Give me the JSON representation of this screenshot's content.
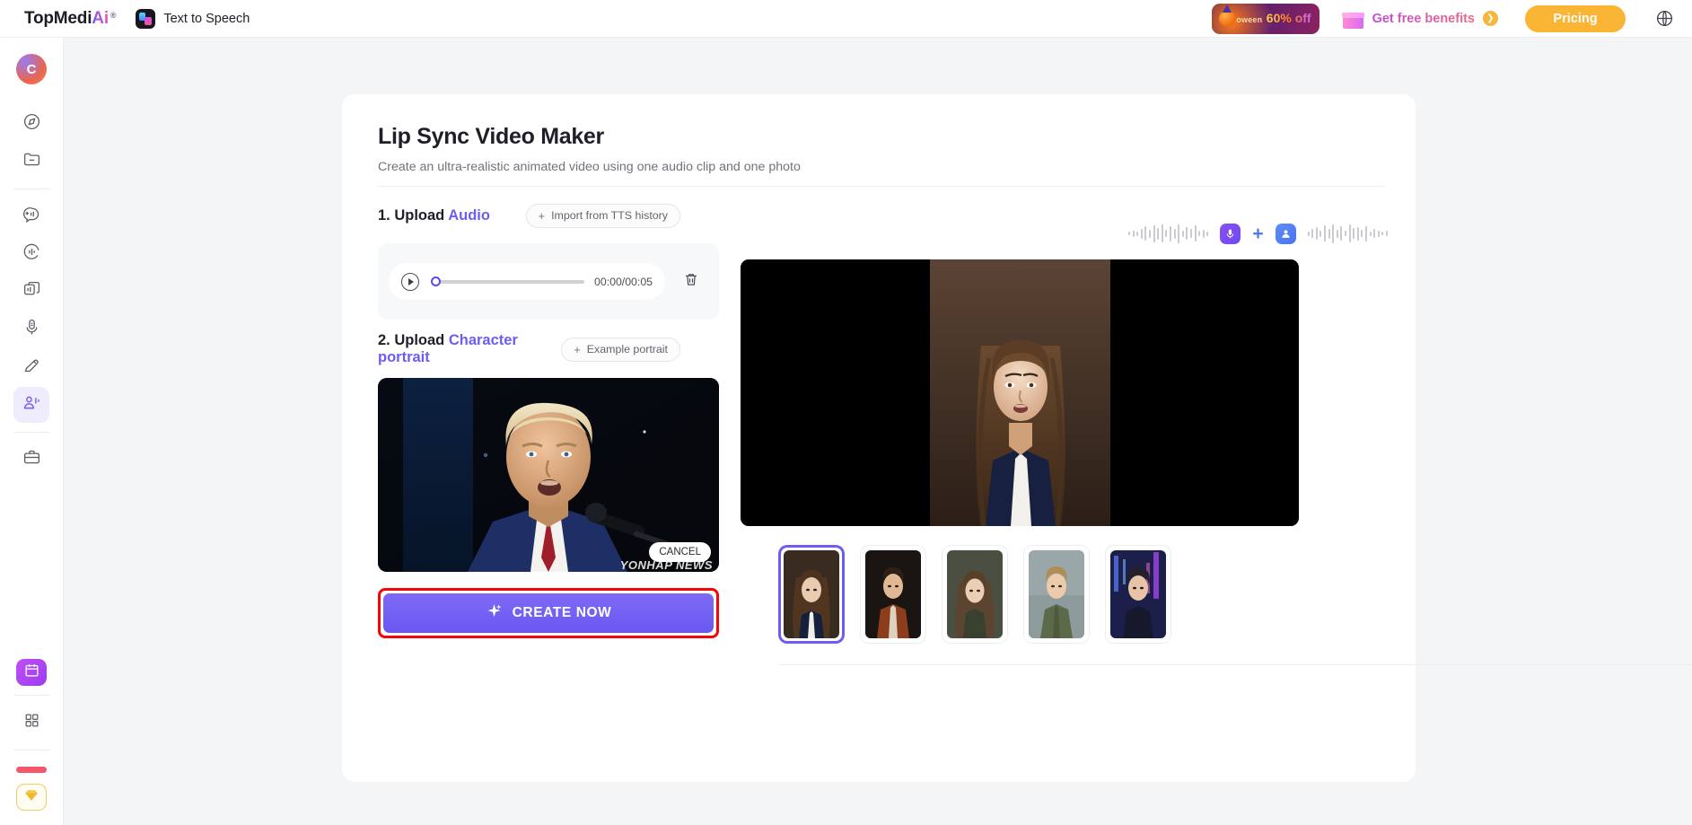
{
  "header": {
    "brand_main": "TopMedi",
    "brand_ai": "Ai",
    "brand_reg": "®",
    "app_name": "Text to Speech",
    "promo": {
      "line1": "Halloween",
      "line2": "60% off"
    },
    "benefits_label": "Get free benefits",
    "benefits_arrow": "❯",
    "pricing_label": "Pricing",
    "globe_icon": "globe-icon"
  },
  "sidebar": {
    "avatar_initial": "C",
    "items": [
      {
        "name": "sidebar-item-explore",
        "icon": "compass-icon"
      },
      {
        "name": "sidebar-item-folder",
        "icon": "folder-icon"
      },
      {
        "name": "sidebar-item-text-to-speech",
        "icon": "speech-bubble-icon"
      },
      {
        "name": "sidebar-item-voice-changer",
        "icon": "voice-wave-circle-icon"
      },
      {
        "name": "sidebar-item-voice-cloning",
        "icon": "layers-icon"
      },
      {
        "name": "sidebar-item-recorder",
        "icon": "microphone-icon"
      },
      {
        "name": "sidebar-item-ai-writer",
        "icon": "pen-icon"
      },
      {
        "name": "sidebar-item-lip-sync",
        "icon": "avatar-voice-icon",
        "active": true
      },
      {
        "name": "sidebar-item-toolbox",
        "icon": "briefcase-icon"
      }
    ],
    "calendar_tile": "calendar-icon",
    "apps_grid": "grid-apps-icon",
    "highlight_bar": "pink-bar",
    "diamond": "diamond-icon"
  },
  "card": {
    "title": "Lip Sync Video Maker",
    "subtitle": "Create an ultra-realistic animated video using one audio clip and one photo",
    "step1": {
      "prefix": "1. Upload ",
      "highlight": "Audio",
      "button": "Import from TTS history",
      "button_plus": "+"
    },
    "audio": {
      "play_icon": "play-icon",
      "progress_percent": 0,
      "timecode": "00:00/00:05",
      "delete_icon": "trash-icon"
    },
    "step2": {
      "prefix": "2. Upload ",
      "highlight": "Character portrait",
      "button": "Example portrait",
      "button_plus": "+"
    },
    "portrait": {
      "name": "uploaded-portrait",
      "cancel_label": "CANCEL",
      "watermark": "YONHAP NEWS"
    },
    "create_button": {
      "label": "CREATE NOW",
      "icon": "sparkle-icon",
      "highlight_color": "#f50606",
      "fill_color": "#6d5cf5"
    },
    "preview": {
      "combine_icons": [
        "waveform",
        "microphone-icon",
        "plus-icon",
        "person-icon",
        "waveform"
      ],
      "video_name": "generated-video-preview"
    },
    "gallery": [
      {
        "name": "portrait-thumb-1",
        "selected": true,
        "alt": "woman-navy-blazer"
      },
      {
        "name": "portrait-thumb-2",
        "selected": false,
        "alt": "man-rust-coat"
      },
      {
        "name": "portrait-thumb-3",
        "selected": false,
        "alt": "woman-olive-top"
      },
      {
        "name": "portrait-thumb-4",
        "selected": false,
        "alt": "man-green-shirt"
      },
      {
        "name": "portrait-thumb-5",
        "selected": false,
        "alt": "woman-cyberpunk"
      }
    ]
  }
}
